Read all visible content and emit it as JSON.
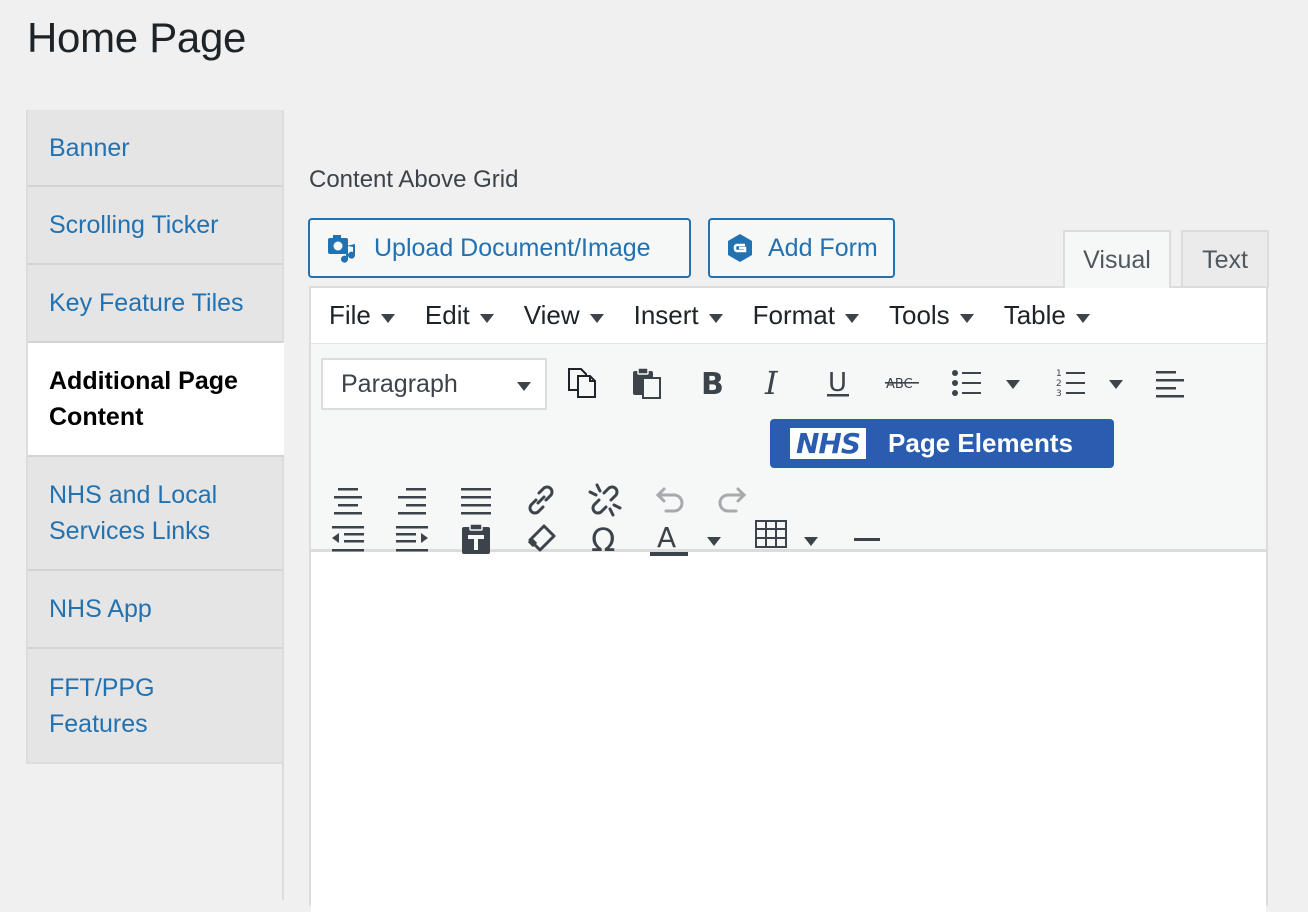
{
  "page": {
    "title": "Home Page"
  },
  "sidebar": {
    "items": [
      {
        "label": "Banner"
      },
      {
        "label": "Scrolling Ticker"
      },
      {
        "label": "Key Feature Tiles"
      },
      {
        "label": "Additional Page Content",
        "active": true
      },
      {
        "label": "NHS and Local Services Links"
      },
      {
        "label": "NHS App"
      },
      {
        "label": "FFT/PPG Features"
      }
    ]
  },
  "editor": {
    "section_label": "Content Above Grid",
    "media_buttons": {
      "upload_label": "Upload Document/Image",
      "form_label": "Add Form"
    },
    "mode_tabs": {
      "visual": "Visual",
      "text": "Text"
    },
    "menu": [
      "File",
      "Edit",
      "View",
      "Insert",
      "Format",
      "Tools",
      "Table"
    ],
    "toolbar": {
      "format_select_value": "Paragraph",
      "nhs_logo": "NHS",
      "nhs_label": "Page Elements",
      "icons": [
        "copy-icon",
        "paste-icon",
        "bold-icon",
        "italic-icon",
        "underline-icon",
        "strikethrough-icon",
        "bullet-list-icon",
        "numbered-list-icon",
        "align-left-icon",
        "align-center-icon",
        "align-right-icon",
        "align-justify-icon",
        "link-icon",
        "unlink-icon",
        "undo-icon",
        "redo-icon",
        "outdent-icon",
        "indent-icon",
        "paste-as-text-icon",
        "clear-formatting-icon",
        "special-character-icon",
        "text-color-icon",
        "table-icon",
        "horizontal-line-icon"
      ]
    }
  },
  "colors": {
    "link_blue": "#2271b1",
    "nhs_blue": "#2a5db0",
    "background": "#f0f0f1"
  }
}
